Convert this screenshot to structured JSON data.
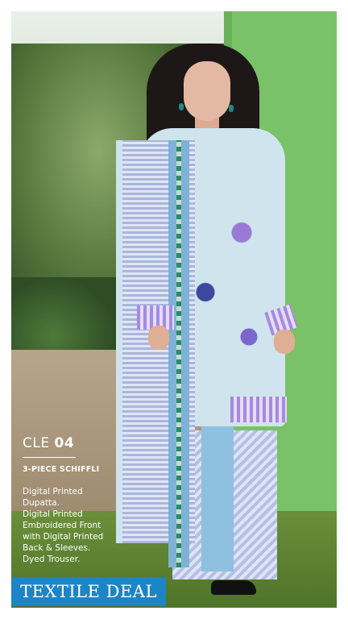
{
  "product": {
    "code_prefix": "CLE",
    "code_number": "04",
    "piece_label": "3-PIECE SCHIFFLI",
    "description_lines": [
      "Digital Printed",
      "Dupatta.",
      "Digital Printed",
      "Embroidered Front",
      "with Digital Printed",
      "Back & Sleeves.",
      "Dyed Trouser."
    ]
  },
  "brand": {
    "name": "TEXTILE DEAL",
    "color": "#1d84c6"
  },
  "colors": {
    "wall": "#79c267",
    "outfit_primary": "#cfe4ec",
    "outfit_accent": "#a58be0"
  }
}
